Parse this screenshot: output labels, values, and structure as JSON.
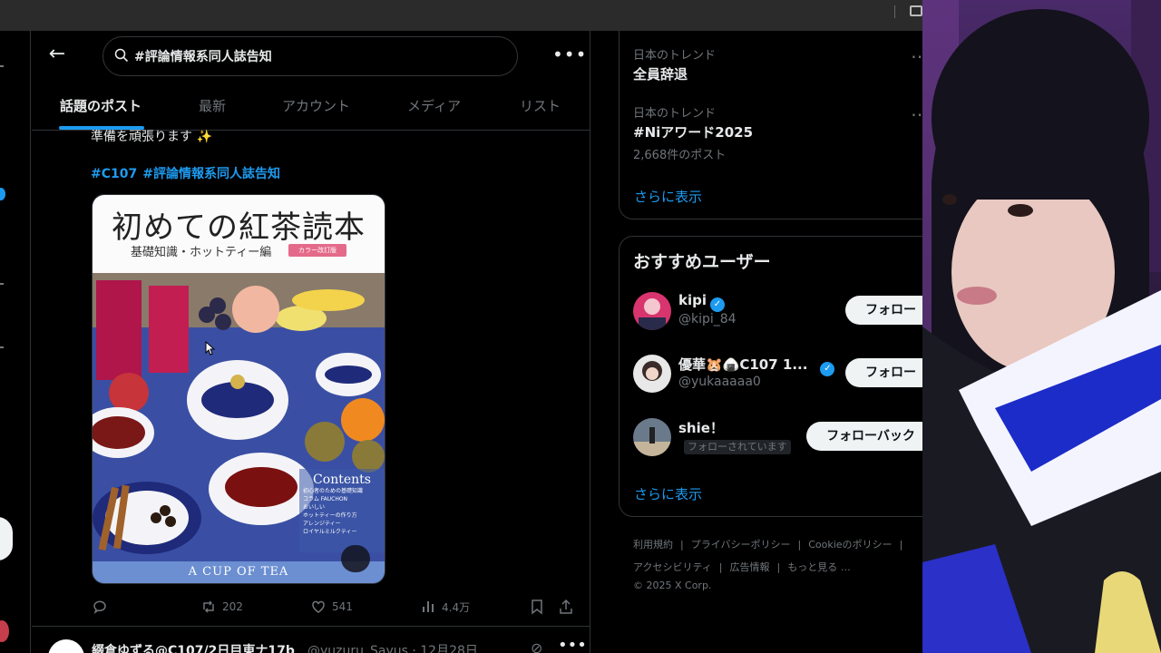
{
  "search": {
    "query": "#評論情報系同人誌告知"
  },
  "tabs": [
    {
      "label": "話題のポスト",
      "active": true
    },
    {
      "label": "最新"
    },
    {
      "label": "アカウント"
    },
    {
      "label": "メディア"
    },
    {
      "label": "リスト"
    }
  ],
  "post": {
    "cut_text": "準備を頑張ります ✨",
    "hashtags": [
      "#C107",
      "#評論情報系同人誌告知"
    ],
    "media": {
      "cover_title": "初めての紅茶読本",
      "cover_subtitle": "基礎知識・ホットティー編",
      "cover_badge": "カラー改訂版",
      "contents_heading": "Contents",
      "contents_lines": [
        "初心者のための基礎知識",
        "コラム FAUCHON",
        "おいしい",
        "ホットティーの作り方",
        "アレンジティー",
        "ロイヤルミルクティー"
      ],
      "bottom_text": "A CUP OF TEA"
    },
    "actions": {
      "retweets": "202",
      "likes": "541",
      "views": "4.4万"
    }
  },
  "next_post": {
    "name": "綴倉ゆずる@C107/2日目東ナ17b",
    "meta": "@yuzuru_Sayus · 12月28日"
  },
  "trends": [
    {
      "category": "日本のトレンド",
      "name": "全員辞退",
      "count": ""
    },
    {
      "category": "日本のトレンド",
      "name": "#Niアワード2025",
      "count": "2,668件のポスト"
    }
  ],
  "trends_show_more": "さらに表示",
  "who_to_follow": {
    "title": "おすすめユーザー",
    "users": [
      {
        "name": "kipi",
        "handle": "@kipi_84",
        "button": "フォロー",
        "verified": true
      },
      {
        "name": "優華🐹🍙C107 1...",
        "handle": "@yukaaaaa0",
        "button": "フォロー",
        "verified": true
      },
      {
        "name": "shie！",
        "handle": "",
        "badge": "フォローされています",
        "button": "フォローバック",
        "verified": false
      }
    ],
    "show_more": "さらに表示"
  },
  "footer": {
    "links": [
      "利用規約",
      "プライバシーポリシー",
      "Cookieのポリシー",
      "アクセシビリティ",
      "広告情報",
      "もっと見る …"
    ],
    "copyright": "© 2025 X Corp."
  },
  "colors": {
    "accent": "#1d9bf0",
    "background": "#000000",
    "border": "#2f3336",
    "muted": "#71767b"
  }
}
